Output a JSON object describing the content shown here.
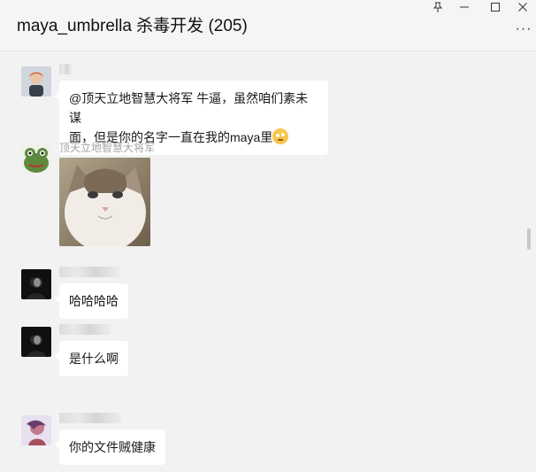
{
  "window": {
    "title": "maya_umbrella 杀毒开发 (205)",
    "controls": {
      "pin": "⊥",
      "minimize": "—",
      "maximize": "☐",
      "close": "✕"
    },
    "more": "···"
  },
  "messages": [
    {
      "sender": "",
      "sender_blurred": true,
      "text": "@顶天立地智慧大将军 牛逼，虽然咱们素未谋",
      "text2": "面，但是你的名字一直在我的maya里",
      "has_emoji": true
    },
    {
      "sender": "顶天立地智慧大将军",
      "sender_blurred": false,
      "image": "cat-photo"
    },
    {
      "sender": "",
      "sender_blurred": true,
      "text": "哈哈哈哈"
    },
    {
      "sender": "",
      "sender_blurred": true,
      "text": "是什么啊"
    },
    {
      "sender": "",
      "sender_blurred": true,
      "text": "你的文件贼健康"
    }
  ],
  "colors": {
    "bubble": "#ffffff",
    "background": "#f2f2f2",
    "sender": "#a3a3a3"
  }
}
